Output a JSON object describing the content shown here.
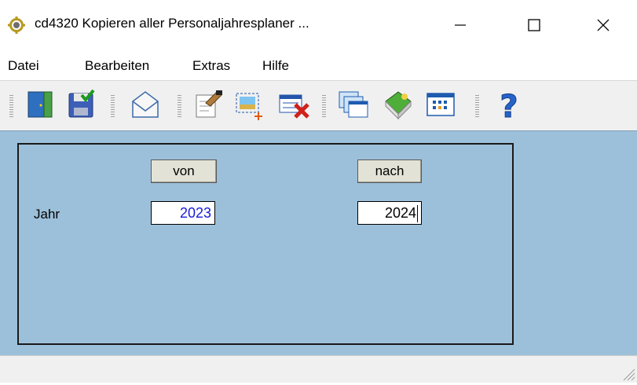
{
  "window": {
    "title": "cd4320 Kopieren aller Personaljahresplaner ...",
    "controls": [
      "minimize-icon",
      "maximize-icon",
      "close-icon"
    ]
  },
  "menu": {
    "items": [
      "Datei",
      "Bearbeiten",
      "Extras",
      "Hilfe"
    ]
  },
  "toolbar": {
    "buttons": [
      "exit-door-icon",
      "save-icon",
      "mail-icon",
      "edit-document-icon",
      "new-picture-icon",
      "delete-icon",
      "copy-windows-icon",
      "book-icon",
      "table-icon",
      "help-icon"
    ]
  },
  "form": {
    "from_header": "von",
    "to_header": "nach",
    "row_label": "Jahr",
    "from_year": "2023",
    "to_year": "2024"
  },
  "colors": {
    "client_bg": "#9dc0da",
    "header_box_bg": "#e2e2d6",
    "from_value_color": "#1a1adb"
  }
}
